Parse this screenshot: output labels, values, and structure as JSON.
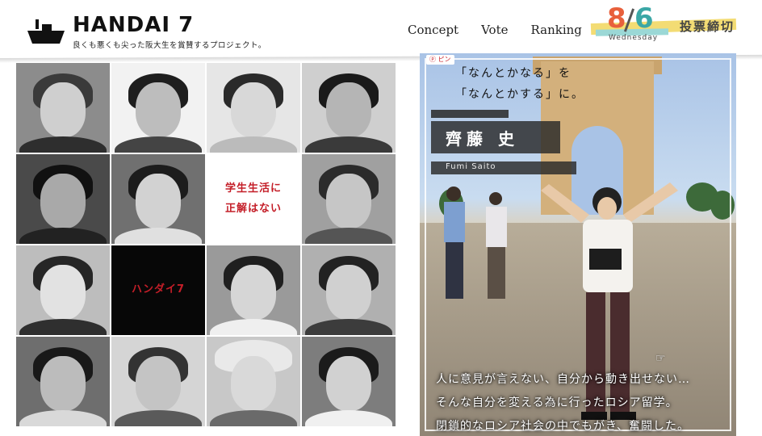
{
  "header": {
    "brand": "HANDAI 7",
    "tagline": "良くも悪くも尖った阪大生を賞賛するプロジェクト。",
    "nav": [
      "Concept",
      "Vote",
      "Ranking"
    ],
    "deadline": {
      "month": "8",
      "day": "6",
      "weekday": "Wednesday",
      "label": "投票締切"
    }
  },
  "grid": {
    "text_tiles": [
      {
        "line1": "学生生活に",
        "line2": "正解はない"
      },
      {
        "line1": "ハンダイ7"
      }
    ]
  },
  "feature": {
    "pin_label": "ピン",
    "quote_line1": "「なんとかなる」を",
    "quote_line2": "「なんとかする」に。",
    "name": "齊藤 史",
    "name_roman": "Fumi Saito",
    "story": [
      "人に意見が言えない、自分から動き出せない…",
      "そんな自分を変える為に行ったロシア留学。",
      "閉鎖的なロシア社会の中でもがき、奮闘した。"
    ]
  },
  "colors": {
    "accent_red": "#c41e28",
    "date_orange": "#e8603c",
    "date_teal": "#3ba7a6",
    "band_yellow": "#f3dc74"
  }
}
